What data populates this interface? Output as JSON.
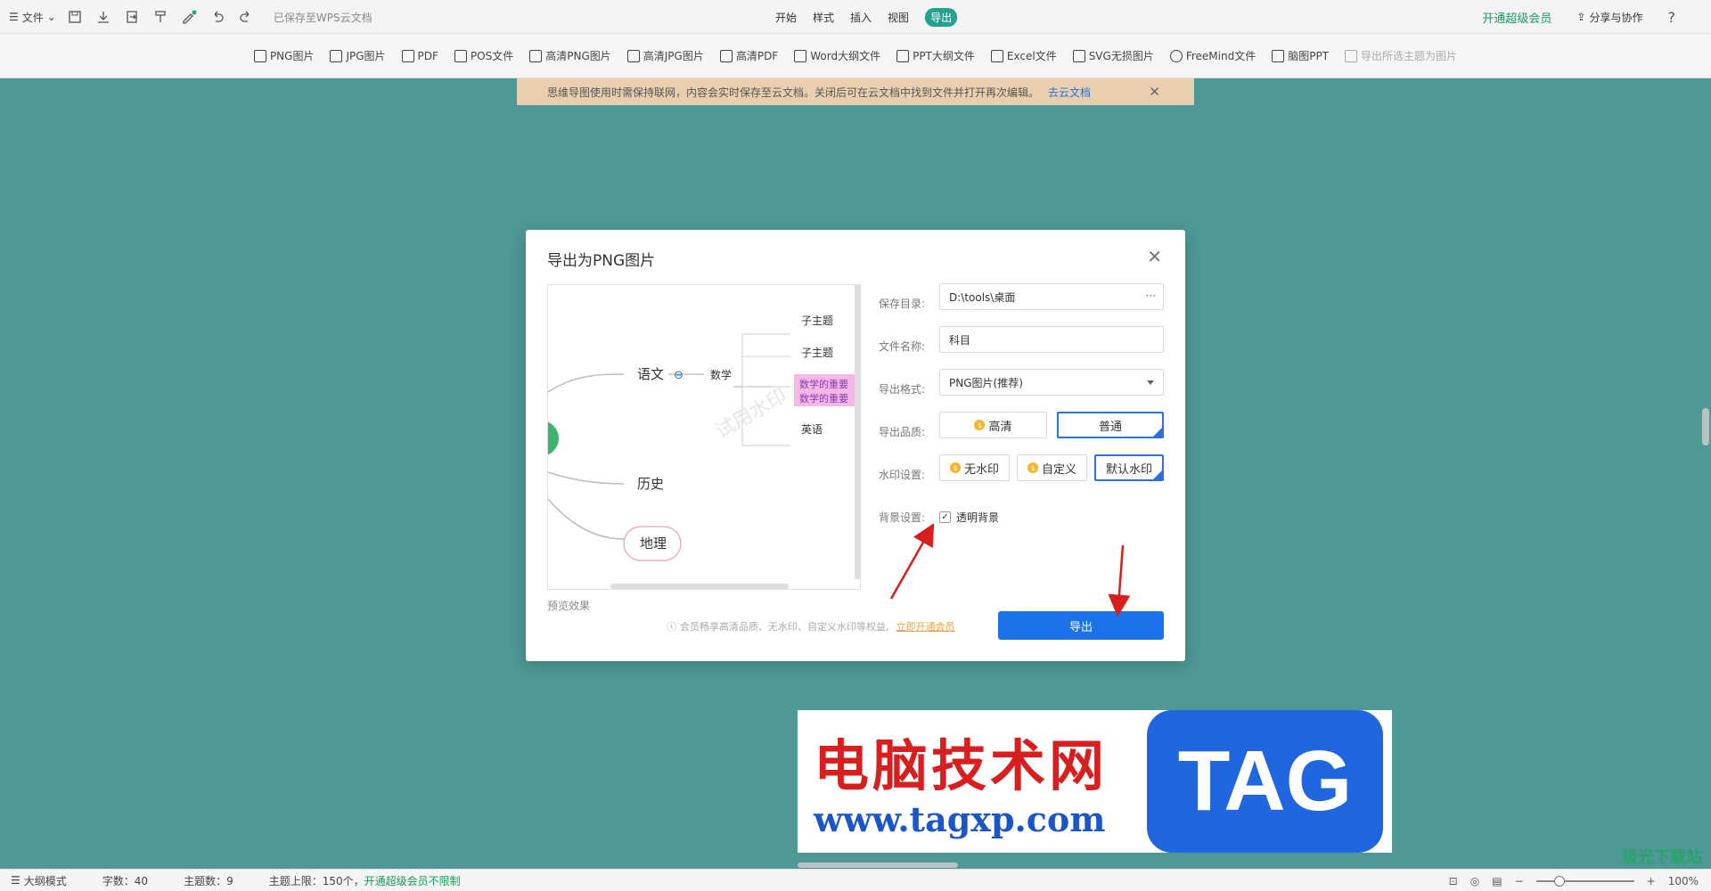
{
  "topbar": {
    "file_menu": "文件",
    "saved_status": "已保存至WPS云文档",
    "tabs": [
      "开始",
      "样式",
      "插入",
      "视图",
      "导出"
    ],
    "vip": "开通超级会员",
    "share": "分享与协作",
    "help": "?"
  },
  "exportbar": {
    "items": [
      "PNG图片",
      "JPG图片",
      "PDF",
      "POS文件",
      "高清PNG图片",
      "高清JPG图片",
      "高清PDF",
      "Word大纲文件",
      "PPT大纲文件",
      "Excel文件",
      "SVG无损图片",
      "FreeMind文件",
      "脑图PPT",
      "导出所选主题为图片"
    ]
  },
  "notice": {
    "text": "思维导图使用时需保持联网，内容会实时保存至云文档。关闭后可在云文档中找到文件并打开再次编辑。",
    "link": "去云文档"
  },
  "dialog": {
    "title": "导出为PNG图片",
    "preview_label": "预览效果",
    "preview": {
      "nodes": [
        "语文",
        "数学",
        "历史",
        "地理",
        "子主题",
        "子主题",
        "数学的重要",
        "数学的重要",
        "英语"
      ],
      "watermark": "试用水印"
    },
    "save_dir_label": "保存目录:",
    "save_dir_value": "D:\\tools\\桌面",
    "save_dir_more": "···",
    "filename_label": "文件名称:",
    "filename_value": "科目",
    "format_label": "导出格式:",
    "format_value": "PNG图片(推荐)",
    "quality_label": "导出品质:",
    "quality_options": [
      "高清",
      "普通"
    ],
    "quality_selected": "普通",
    "watermark_label": "水印设置:",
    "watermark_options": [
      "无水印",
      "自定义",
      "默认水印"
    ],
    "watermark_selected": "默认水印",
    "bg_label": "背景设置:",
    "bg_option": "透明背景",
    "bg_checked": true,
    "promo_text": "会员畅享高清品质、无水印、自定义水印等权益,",
    "promo_link": "立即开通会员",
    "export_button": "导出"
  },
  "banner": {
    "cn": "电脑技术网",
    "url": "www.tagxp.com",
    "tag": "TAG"
  },
  "statusbar": {
    "outline_mode": "大纲模式",
    "word_count": "字数：40",
    "topic_count": "主题数：9",
    "topic_limit": "主题上限：150个，",
    "vip_unlimited": "开通超级会员不限制",
    "zoom": "100%"
  },
  "corner_logo": "极光下载站",
  "colors": {
    "canvas": "#4e9896",
    "accent": "#1a73e8",
    "vip_green": "#1a9a5a",
    "arrow_red": "#d91e1e"
  }
}
